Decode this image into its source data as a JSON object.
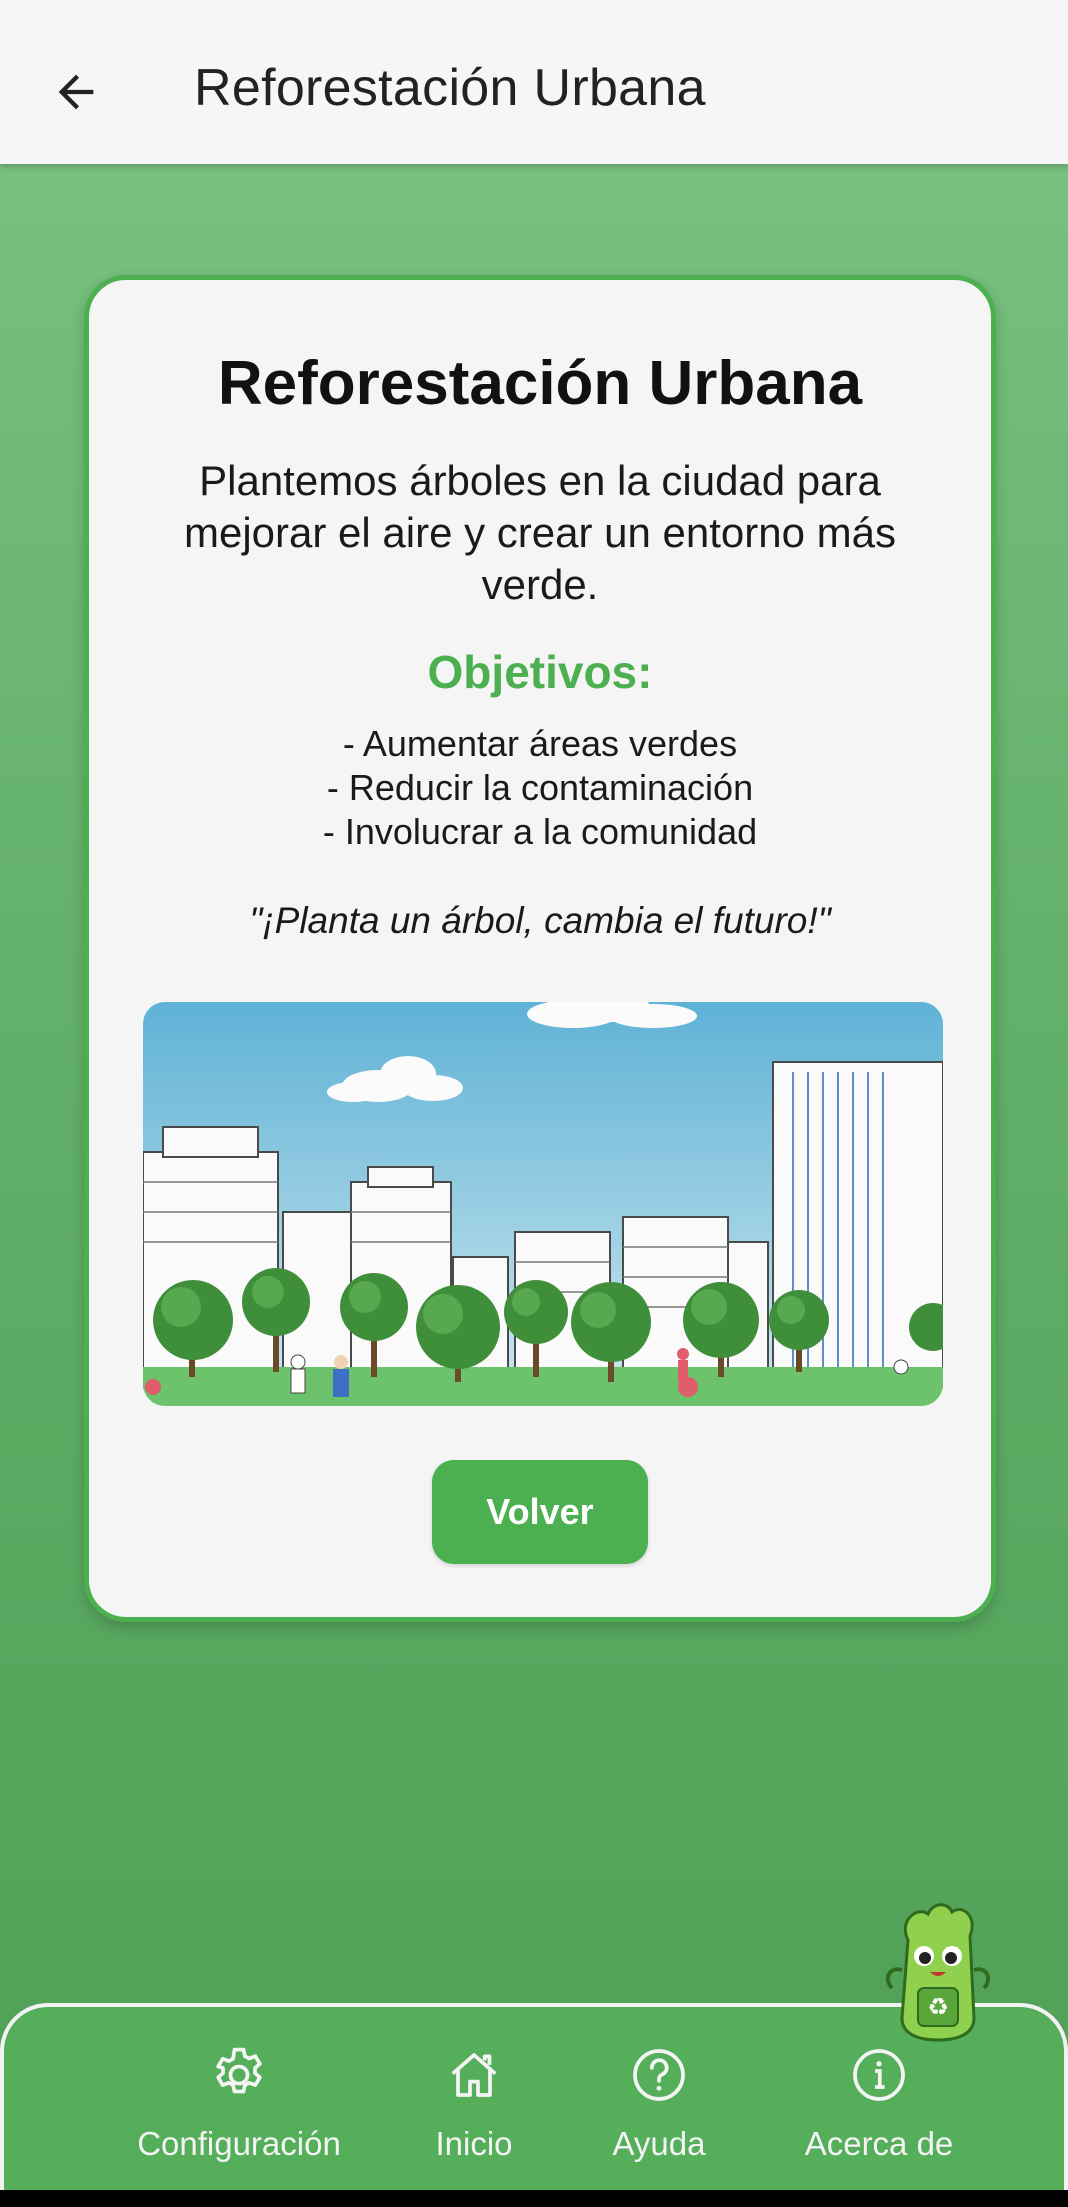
{
  "topbar": {
    "back_icon": "arrow-left-icon",
    "title": "Reforestación Urbana"
  },
  "card": {
    "title": "Reforestación Urbana",
    "description": "Plantemos árboles en la ciudad para mejorar el aire y crear un entorno más verde.",
    "objectives_title": "Objetivos:",
    "objectives": [
      "- Aumentar áreas verdes",
      "- Reducir la contaminación",
      "- Involucrar a la comunidad"
    ],
    "quote": "\"¡Planta un árbol, cambia el futuro!\"",
    "button_label": "Volver"
  },
  "bottom_nav": {
    "items": [
      {
        "label": "Configuración",
        "icon": "gear-icon"
      },
      {
        "label": "Inicio",
        "icon": "home-icon"
      },
      {
        "label": "Ayuda",
        "icon": "help-icon"
      },
      {
        "label": "Acerca de",
        "icon": "info-icon"
      }
    ]
  },
  "colors": {
    "accent": "#4caf50",
    "background_top": "#7cc383",
    "background_bottom": "#4f9f56",
    "card": "#f5f5f5"
  }
}
